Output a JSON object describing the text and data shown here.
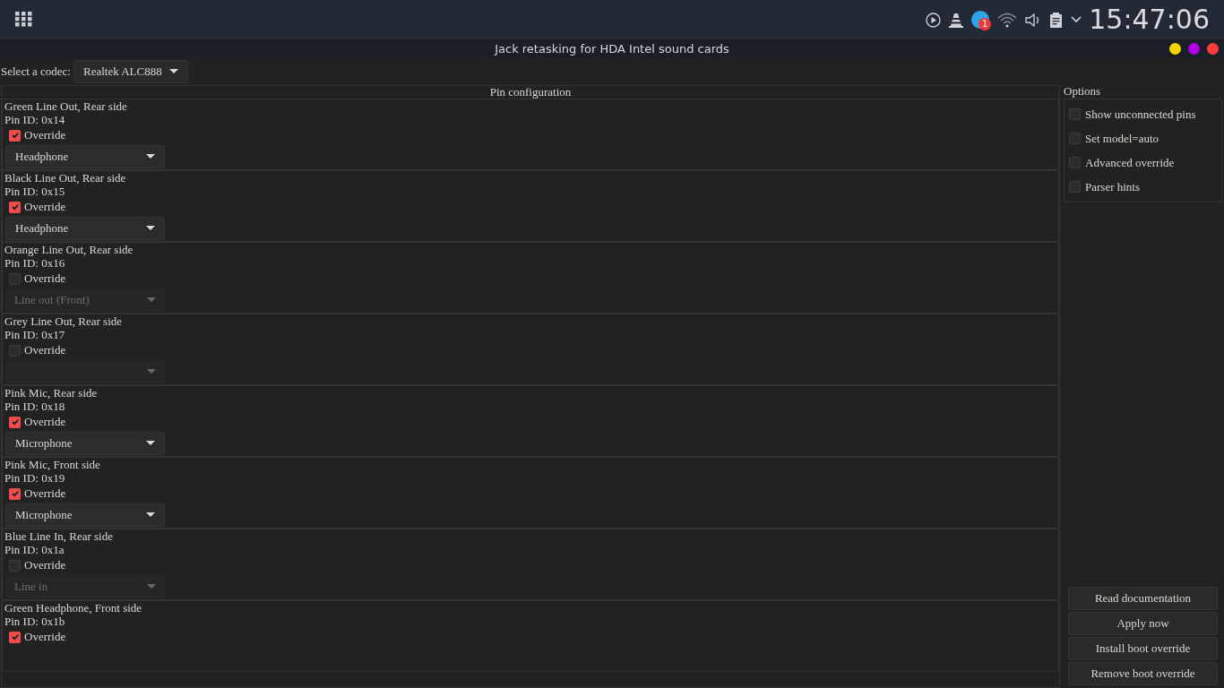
{
  "topbar": {
    "clock": "15:47:06",
    "badge": "1"
  },
  "window": {
    "title": "Jack retasking for HDA Intel sound cards",
    "buttons": [
      {
        "color": "#f5d400"
      },
      {
        "color": "#b000e8"
      },
      {
        "color": "#ff3b3b"
      }
    ]
  },
  "codec": {
    "label": "Select a codec:",
    "value": "Realtek ALC888"
  },
  "pin_panel": {
    "title": "Pin configuration",
    "pins": [
      {
        "name": "Green Line Out, Rear side",
        "pin_id": "Pin ID: 0x14",
        "override": {
          "label": "Override",
          "checked": true
        },
        "dropdown": {
          "value": "Headphone",
          "disabled": false
        }
      },
      {
        "name": "Black Line Out, Rear side",
        "pin_id": "Pin ID: 0x15",
        "override": {
          "label": "Override",
          "checked": true
        },
        "dropdown": {
          "value": "Headphone",
          "disabled": false
        }
      },
      {
        "name": "Orange Line Out, Rear side",
        "pin_id": "Pin ID: 0x16",
        "override": {
          "label": "Override",
          "checked": false
        },
        "dropdown": {
          "value": "Line out (Front)",
          "disabled": true
        }
      },
      {
        "name": "Grey Line Out, Rear side",
        "pin_id": "Pin ID: 0x17",
        "override": {
          "label": "Override",
          "checked": false
        },
        "dropdown": {
          "disabled": true
        }
      },
      {
        "name": "Pink Mic, Rear side",
        "pin_id": "Pin ID: 0x18",
        "override": {
          "label": "Override",
          "checked": true
        },
        "dropdown": {
          "value": "Microphone",
          "disabled": false
        }
      },
      {
        "name": "Pink Mic, Front side",
        "pin_id": "Pin ID: 0x19",
        "override": {
          "label": "Override",
          "checked": true
        },
        "dropdown": {
          "value": "Microphone",
          "disabled": false
        }
      },
      {
        "name": "Blue Line In, Rear side",
        "pin_id": "Pin ID: 0x1a",
        "override": {
          "label": "Override",
          "checked": false
        },
        "dropdown": {
          "value": "Line in",
          "disabled": true
        }
      },
      {
        "name": "Green Headphone, Front side",
        "pin_id": "Pin ID: 0x1b",
        "override": {
          "label": "Override",
          "checked": true
        }
      }
    ]
  },
  "options": {
    "title": "Options",
    "items": [
      {
        "label": "Show unconnected pins",
        "checked": false
      },
      {
        "label": "Set model=auto",
        "checked": false
      },
      {
        "label": "Advanced override",
        "checked": false
      },
      {
        "label": "Parser hints",
        "checked": false
      }
    ]
  },
  "actions": [
    "Read documentation",
    "Apply now",
    "Install boot override",
    "Remove boot override"
  ]
}
